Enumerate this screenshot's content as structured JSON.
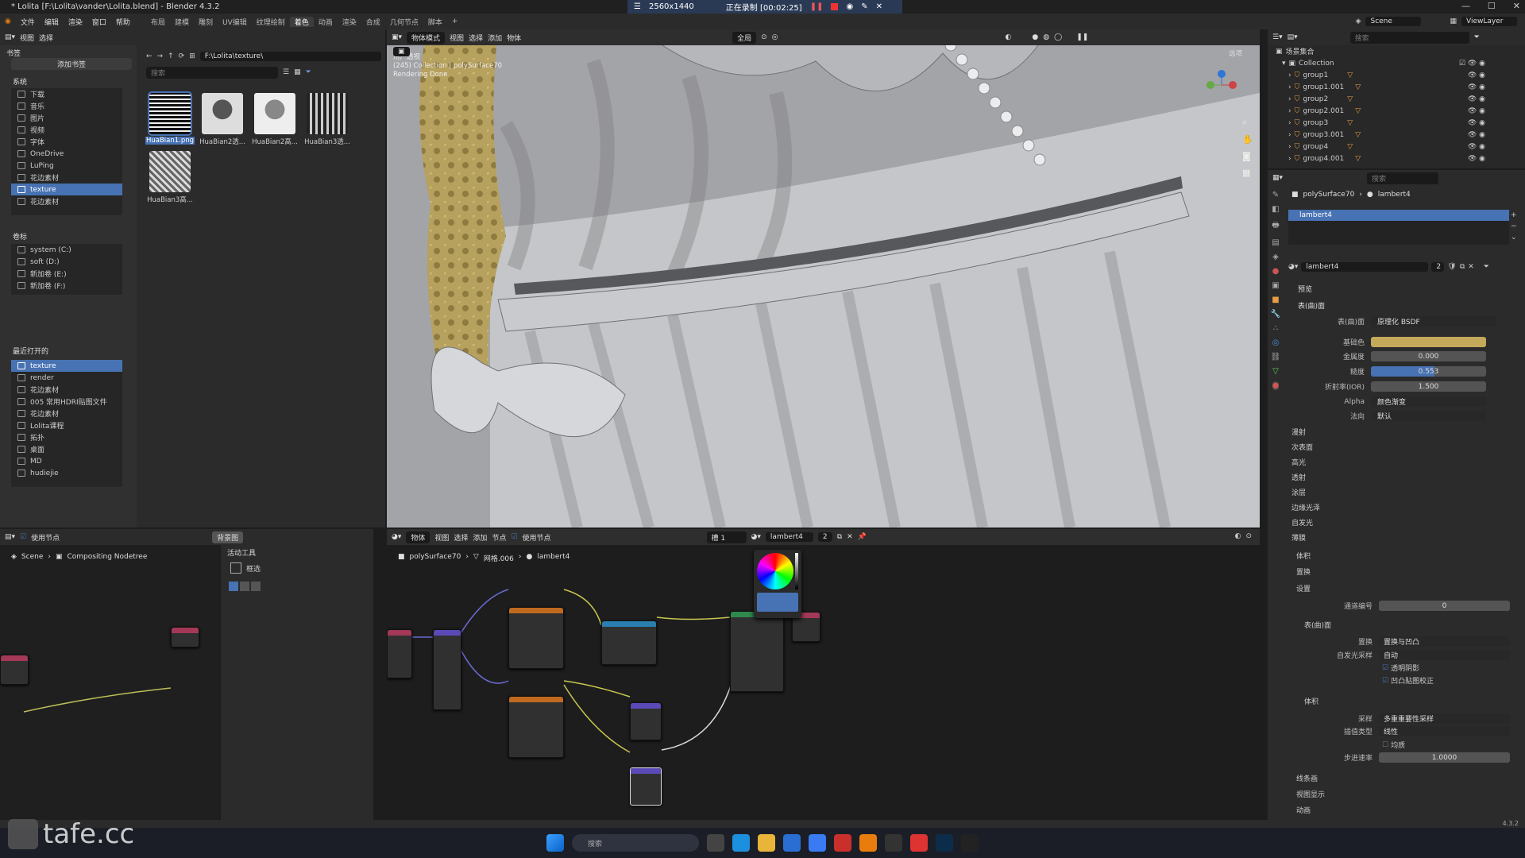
{
  "window": {
    "title": "* Lolita [F:\\Lolita\\vander\\Lolita.blend] - Blender 4.3.2"
  },
  "recorder": {
    "resolution": "2560x1440",
    "status": "正在录制 [00:02:25]"
  },
  "menu": {
    "items": [
      "文件",
      "编辑",
      "渲染",
      "窗口",
      "帮助"
    ],
    "workspaces": [
      "布局",
      "建模",
      "雕刻",
      "UV编辑",
      "纹理绘制",
      "着色",
      "动画",
      "渲染",
      "合成",
      "几何节点",
      "脚本"
    ],
    "active_workspace": "着色",
    "scene_label": "Scene",
    "viewlayer_label": "ViewLayer"
  },
  "file_browser": {
    "menus": [
      "视图",
      "选择"
    ],
    "bookmarks_title": "书签",
    "add_bookmark": "添加书签",
    "system_title": "系统",
    "system_items": [
      "下载",
      "音乐",
      "图片",
      "视频",
      "字体",
      "OneDrive",
      "LuPing",
      "花边素材",
      "texture",
      "花边素材"
    ],
    "system_selected": "texture",
    "volumes_title": "卷标",
    "volumes": [
      "system (C:)",
      "soft (D:)",
      "新加卷 (E:)",
      "新加卷 (F:)"
    ],
    "recent_title": "最近打开的",
    "recent": [
      "texture",
      "render",
      "花边素材",
      "005 常用HDRI贴图文件",
      "花边素材",
      "Lolita课程",
      "拓扑",
      "桌面",
      "MD",
      "hudiejie"
    ],
    "recent_selected": "texture",
    "path": "F:\\Lolita\\texture\\",
    "search_placeholder": "搜索",
    "files": [
      "HuaBian1.png",
      "HuaBian2透...",
      "HuaBian2高...",
      "HuaBian3透...",
      "HuaBian3高..."
    ],
    "selected_file": "HuaBian1.png"
  },
  "viewport": {
    "mode": "物体模式",
    "menus": [
      "视图",
      "选择",
      "添加",
      "物体"
    ],
    "transform": "全局",
    "options_label": "选项",
    "overlay_line1": "用户透视",
    "overlay_line2": "(245) Collection | polySurface70",
    "overlay_line3": "Rendering Done"
  },
  "outliner": {
    "search_placeholder": "搜索",
    "root": "场景集合",
    "collection": "Collection",
    "items": [
      "group1",
      "group1.001",
      "group2",
      "group2.001",
      "group3",
      "group3.001",
      "group4",
      "group4.001"
    ]
  },
  "properties": {
    "search_placeholder": "搜索",
    "breadcrumb_object": "polySurface70",
    "breadcrumb_material": "lambert4",
    "slot": "lambert4",
    "material_name": "lambert4",
    "users": "2",
    "preview_label": "预览",
    "surface_label": "表(曲)面",
    "surface_shader_label": "表(曲)面",
    "surface_shader": "原理化 BSDF",
    "base_color_label": "基础色",
    "base_color": "#c4a95a",
    "metallic_label": "金属度",
    "metallic": "0.000",
    "metallic_fill": 0.0,
    "roughness_label": "糙度",
    "roughness": "0.553",
    "roughness_fill": 0.553,
    "ior_label": "折射率(IOR)",
    "ior": "1.500",
    "alpha_label": "Alpha",
    "alpha": "颜色渐变",
    "normal_label": "法向",
    "normal": "默认",
    "subsections": [
      "漫射",
      "次表面",
      "高光",
      "透射",
      "涂层",
      "边缘光泽",
      "自发光",
      "薄膜"
    ],
    "volume_label": "体积",
    "displacement_label": "置换",
    "settings_label": "设置",
    "pass_index_label": "通道编号",
    "pass_index": "0",
    "settings_surface_label": "表(曲)面",
    "displacement_method_label": "置换",
    "displacement_method": "置换与凹凸",
    "emission_sampling_label": "自发光采样",
    "emission_sampling": "自动",
    "transparent_shadow": "透明阴影",
    "bump_map_correction": "凹凸贴图校正",
    "settings_volume_label": "体积",
    "sampling_label": "采样",
    "sampling": "多重重要性采样",
    "interpolation_label": "插值类型",
    "interpolation": "线性",
    "homogeneous": "均质",
    "step_rate_label": "步进速率",
    "step_rate": "1.0000",
    "lineart_label": "线条画",
    "viewport_display_label": "视图显示",
    "animation_label": "动画",
    "version": "4.3.2"
  },
  "compositor": {
    "use_nodes": "使用节点",
    "backdrop": "背景图",
    "breadcrumb_scene": "Scene",
    "breadcrumb_tree": "Compositing Nodetree",
    "active_tool": "活动工具",
    "tool_name": "框选"
  },
  "shader_editor": {
    "object_mode": "物体",
    "menus": [
      "视图",
      "选择",
      "添加",
      "节点"
    ],
    "use_nodes": "使用节点",
    "slot": "槽 1",
    "material": "lambert4",
    "users": "2",
    "breadcrumb_object": "polySurface70",
    "breadcrumb_mesh": "网格.006",
    "breadcrumb_material": "lambert4"
  },
  "taskbar": {
    "search_placeholder": "搜索",
    "watermark": "tafe.cc"
  },
  "colors": {
    "accent": "#4772b3",
    "lace": "#b7a15e"
  }
}
